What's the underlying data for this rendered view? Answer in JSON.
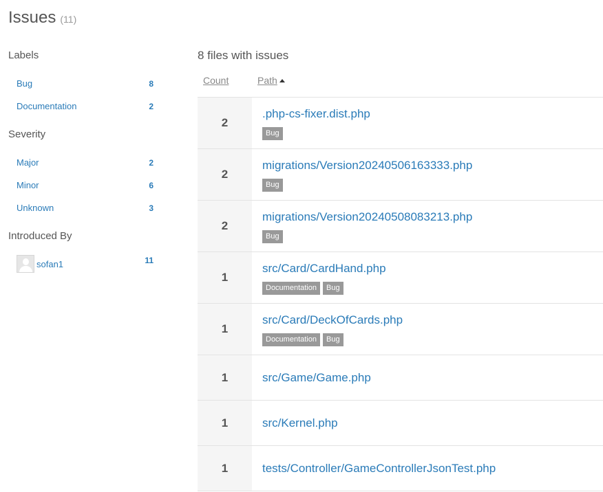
{
  "header": {
    "title": "Issues",
    "count": "(11)"
  },
  "sidebar": {
    "labels": {
      "title": "Labels",
      "items": [
        {
          "label": "Bug",
          "count": "8"
        },
        {
          "label": "Documentation",
          "count": "2"
        }
      ]
    },
    "severity": {
      "title": "Severity",
      "items": [
        {
          "label": "Major",
          "count": "2"
        },
        {
          "label": "Minor",
          "count": "6"
        },
        {
          "label": "Unknown",
          "count": "3"
        }
      ]
    },
    "introduced_by": {
      "title": "Introduced By",
      "items": [
        {
          "name": "sofan1",
          "count": "11",
          "icon": "avatar-placeholder-icon"
        }
      ]
    }
  },
  "main": {
    "heading": "8 files with issues",
    "columns": {
      "count": "Count",
      "path": "Path",
      "sort_icon": "sort-ascending-icon"
    },
    "files": [
      {
        "count": "2",
        "path": ".php-cs-fixer.dist.php",
        "tags": [
          "Bug"
        ]
      },
      {
        "count": "2",
        "path": "migrations/Version20240506163333.php",
        "tags": [
          "Bug"
        ]
      },
      {
        "count": "2",
        "path": "migrations/Version20240508083213.php",
        "tags": [
          "Bug"
        ]
      },
      {
        "count": "1",
        "path": "src/Card/CardHand.php",
        "tags": [
          "Documentation",
          "Bug"
        ]
      },
      {
        "count": "1",
        "path": "src/Card/DeckOfCards.php",
        "tags": [
          "Documentation",
          "Bug"
        ]
      },
      {
        "count": "1",
        "path": "src/Game/Game.php",
        "tags": []
      },
      {
        "count": "1",
        "path": "src/Kernel.php",
        "tags": []
      },
      {
        "count": "1",
        "path": "tests/Controller/GameControllerJsonTest.php",
        "tags": []
      }
    ]
  },
  "colors": {
    "link": "#2a7bb8",
    "tag_bg": "#999999",
    "count_bg": "#f5f5f5",
    "text": "#555555"
  }
}
